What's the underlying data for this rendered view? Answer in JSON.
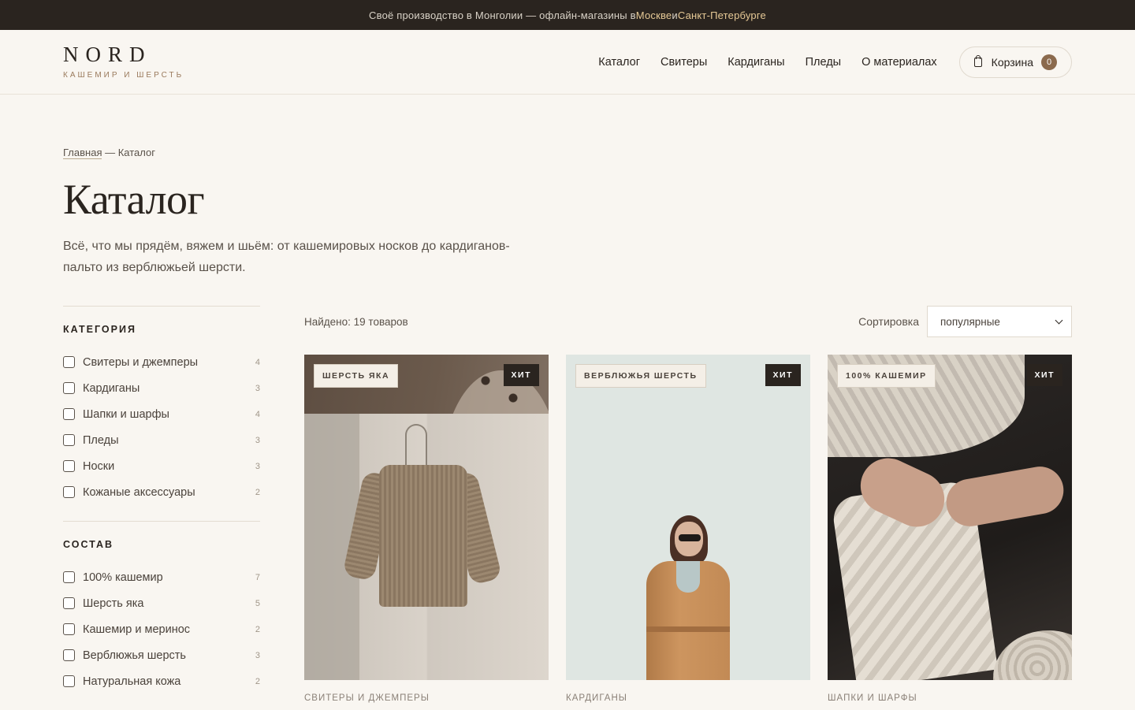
{
  "topbar": {
    "text_before": "Своё производство в Монголии — офлайн-магазины в ",
    "city_1": "Москве",
    "and": " и ",
    "city_2": "Санкт-Петербурге"
  },
  "header": {
    "logo": "NORD",
    "logo_sub": "КАШЕМИР И ШЕРСТЬ",
    "nav": [
      "Каталог",
      "Свитеры",
      "Кардиганы",
      "Пледы",
      "О материалах"
    ],
    "cart_label": "Корзина",
    "cart_count": "0"
  },
  "breadcrumb": {
    "home": "Главная",
    "sep": " — ",
    "current": "Каталог"
  },
  "page": {
    "title": "Каталог",
    "intro": "Всё, что мы прядём, вяжем и шьём: от кашемировых носков до кардиганов-пальто из верблюжьей шерсти."
  },
  "filters": [
    {
      "title": "КАТЕГОРИЯ",
      "items": [
        {
          "label": "Свитеры и джемперы",
          "count": "4"
        },
        {
          "label": "Кардиганы",
          "count": "3"
        },
        {
          "label": "Шапки и шарфы",
          "count": "4"
        },
        {
          "label": "Пледы",
          "count": "3"
        },
        {
          "label": "Носки",
          "count": "3"
        },
        {
          "label": "Кожаные аксессуары",
          "count": "2"
        }
      ]
    },
    {
      "title": "СОСТАВ",
      "items": [
        {
          "label": "100% кашемир",
          "count": "7"
        },
        {
          "label": "Шерсть яка",
          "count": "5"
        },
        {
          "label": "Кашемир и меринос",
          "count": "2"
        },
        {
          "label": "Верблюжья шерсть",
          "count": "3"
        },
        {
          "label": "Натуральная кожа",
          "count": "2"
        }
      ]
    }
  ],
  "results": {
    "found": "Найдено: 19 товаров",
    "sort_label": "Сортировка",
    "sort_value": "популярные"
  },
  "products": [
    {
      "material": "ШЕРСТЬ ЯКА",
      "badge": "ХИТ",
      "category": "СВИТЕРЫ И ДЖЕМПЕРЫ"
    },
    {
      "material": "ВЕРБЛЮЖЬЯ ШЕРСТЬ",
      "badge": "ХИТ",
      "category": "КАРДИГАНЫ"
    },
    {
      "material": "100% КАШЕМИР",
      "badge": "ХИТ",
      "category": "ШАПКИ И ШАРФЫ"
    }
  ]
}
